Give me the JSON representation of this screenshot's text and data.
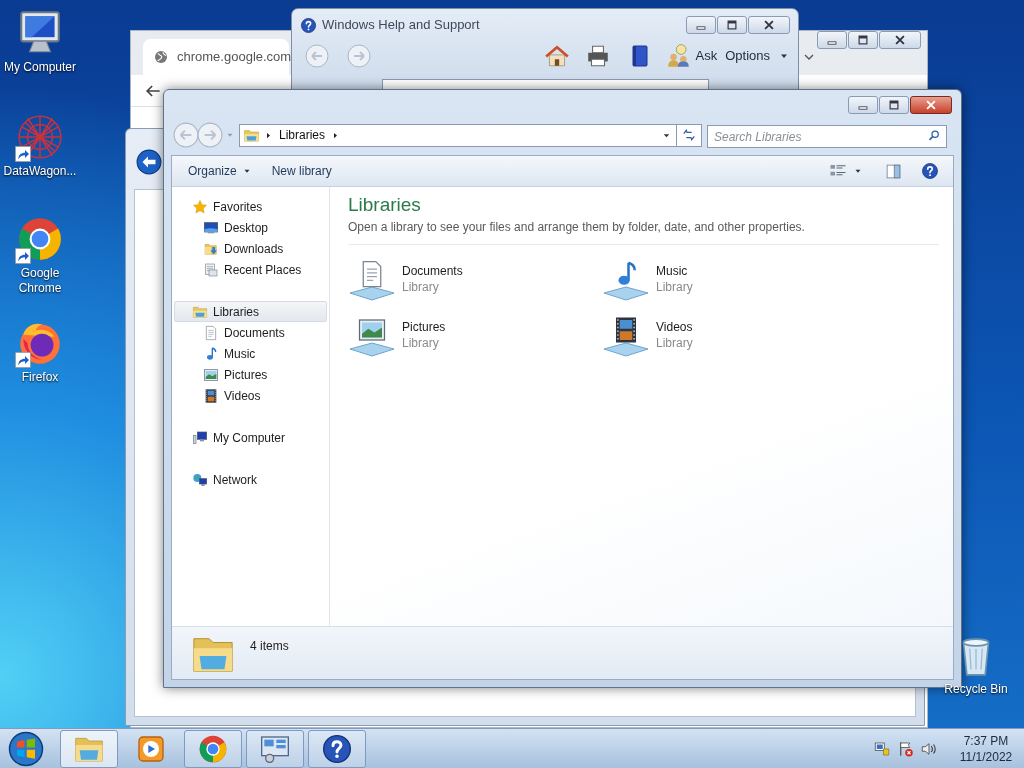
{
  "desktop_icons": [
    {
      "label": "My Computer",
      "kind": "computer",
      "shortcut": false
    },
    {
      "label": "DataWagon...",
      "kind": "datawagon",
      "shortcut": true
    },
    {
      "label": "Google Chrome",
      "kind": "chrome",
      "shortcut": true
    },
    {
      "label": "Firefox",
      "kind": "firefox",
      "shortcut": true
    },
    {
      "label": "Recycle Bin",
      "kind": "recycle",
      "shortcut": false
    }
  ],
  "browser_window": {
    "tab_title": "chrome.google.com"
  },
  "help_window": {
    "title": "Windows Help and Support",
    "buttons": [
      {
        "label": "Ask",
        "kind": "button"
      },
      {
        "label": "Options",
        "kind": "menu"
      }
    ]
  },
  "explorer": {
    "path": [
      "Libraries"
    ],
    "search": {
      "placeholder": "Search Libraries"
    },
    "commands": [
      {
        "label": "Organize",
        "kind": "menu"
      },
      {
        "label": "New library",
        "kind": "button"
      }
    ],
    "navigation": [
      {
        "label": "Favorites",
        "kind": "star",
        "selected": false,
        "children": [
          {
            "label": "Desktop",
            "kind": "desktop",
            "selected": false
          },
          {
            "label": "Downloads",
            "kind": "downloads",
            "selected": false
          },
          {
            "label": "Recent Places",
            "kind": "recent",
            "selected": false
          }
        ]
      },
      {
        "label": "Libraries",
        "kind": "library",
        "selected": true,
        "children": [
          {
            "label": "Documents",
            "kind": "document",
            "selected": false
          },
          {
            "label": "Music",
            "kind": "music",
            "selected": false
          },
          {
            "label": "Pictures",
            "kind": "picture",
            "selected": false
          },
          {
            "label": "Videos",
            "kind": "video",
            "selected": false
          }
        ]
      },
      {
        "label": "My Computer",
        "kind": "netpc",
        "selected": false
      },
      {
        "label": "Network",
        "kind": "network",
        "selected": false
      }
    ],
    "heading": "Libraries",
    "description": "Open a library to see your files and arrange them by folder, date, and other properties.",
    "libraries": [
      {
        "name": "Documents",
        "type": "Library",
        "kind": "document"
      },
      {
        "name": "Music",
        "type": "Library",
        "kind": "music"
      },
      {
        "name": "Pictures",
        "type": "Library",
        "kind": "picture"
      },
      {
        "name": "Videos",
        "type": "Library",
        "kind": "video"
      }
    ],
    "status": "4 items"
  },
  "taskbar": {
    "items": [
      {
        "kind": "explorer",
        "running": true,
        "selected": true
      },
      {
        "kind": "media",
        "running": false,
        "selected": false
      },
      {
        "kind": "chrome",
        "running": true,
        "selected": false
      },
      {
        "kind": "control",
        "running": true,
        "selected": false
      },
      {
        "kind": "help",
        "running": true,
        "selected": false
      }
    ],
    "time": "7:37 PM",
    "date": "11/1/2022"
  }
}
